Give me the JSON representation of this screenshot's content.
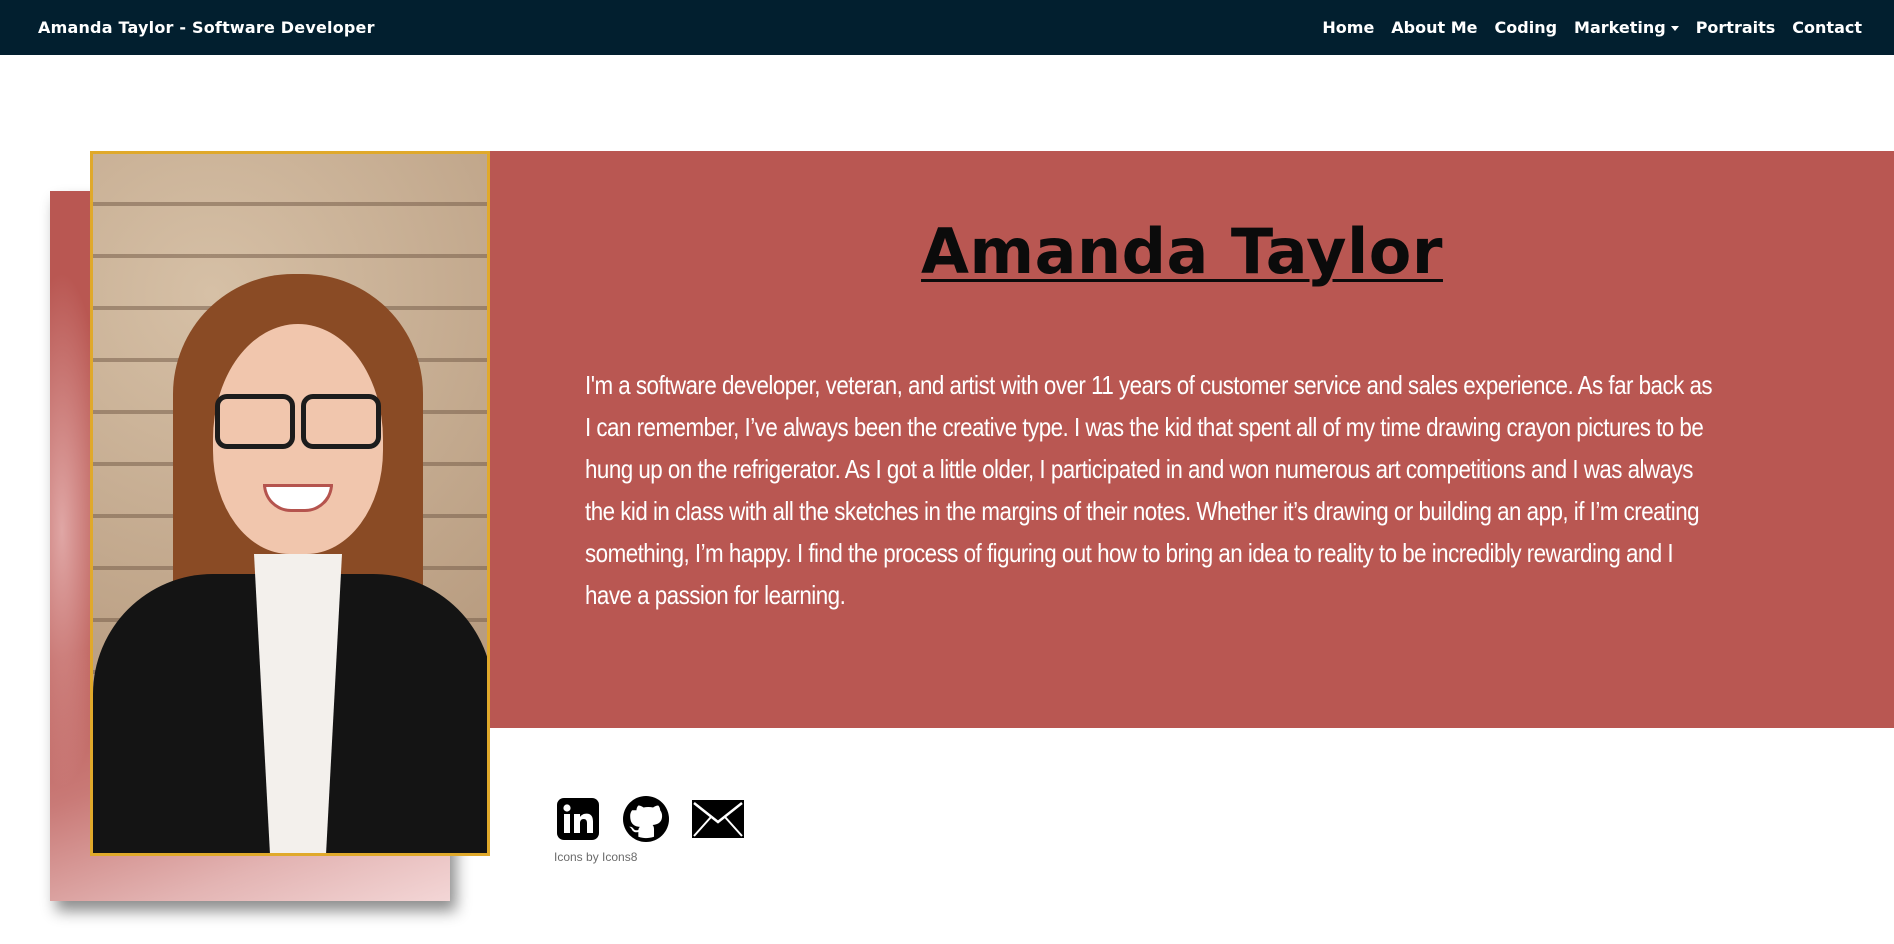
{
  "navbar": {
    "brand": "Amanda Taylor - Software Developer",
    "links": [
      {
        "label": "Home"
      },
      {
        "label": "About Me"
      },
      {
        "label": "Coding"
      },
      {
        "label": "Marketing"
      },
      {
        "label": "Portraits"
      },
      {
        "label": "Contact"
      }
    ]
  },
  "hero": {
    "name": "Amanda Taylor",
    "bio": "I'm a software developer, veteran, and artist with over 11 years of customer service and sales experience. As far back as I can remember, I’ve always been the creative type. I was the kid that spent all of my time drawing crayon pictures to be hung up on the refrigerator. As I got a little older, I participated in and won numerous art competitions and I was always the kid in class with all the sketches in the margins of their notes. Whether it’s drawing or building an app, if I’m creating something, I’m happy. I find the process of figuring out how to bring an idea to reality to be incredibly rewarding and I have a passion for learning."
  },
  "social": {
    "icons": [
      "linkedin-icon",
      "github-icon",
      "email-icon"
    ],
    "credit": "Icons by Icons8"
  },
  "colors": {
    "navbar_bg": "#021f2f",
    "hero_bg": "#b95752",
    "portrait_border": "#e0a92b"
  }
}
